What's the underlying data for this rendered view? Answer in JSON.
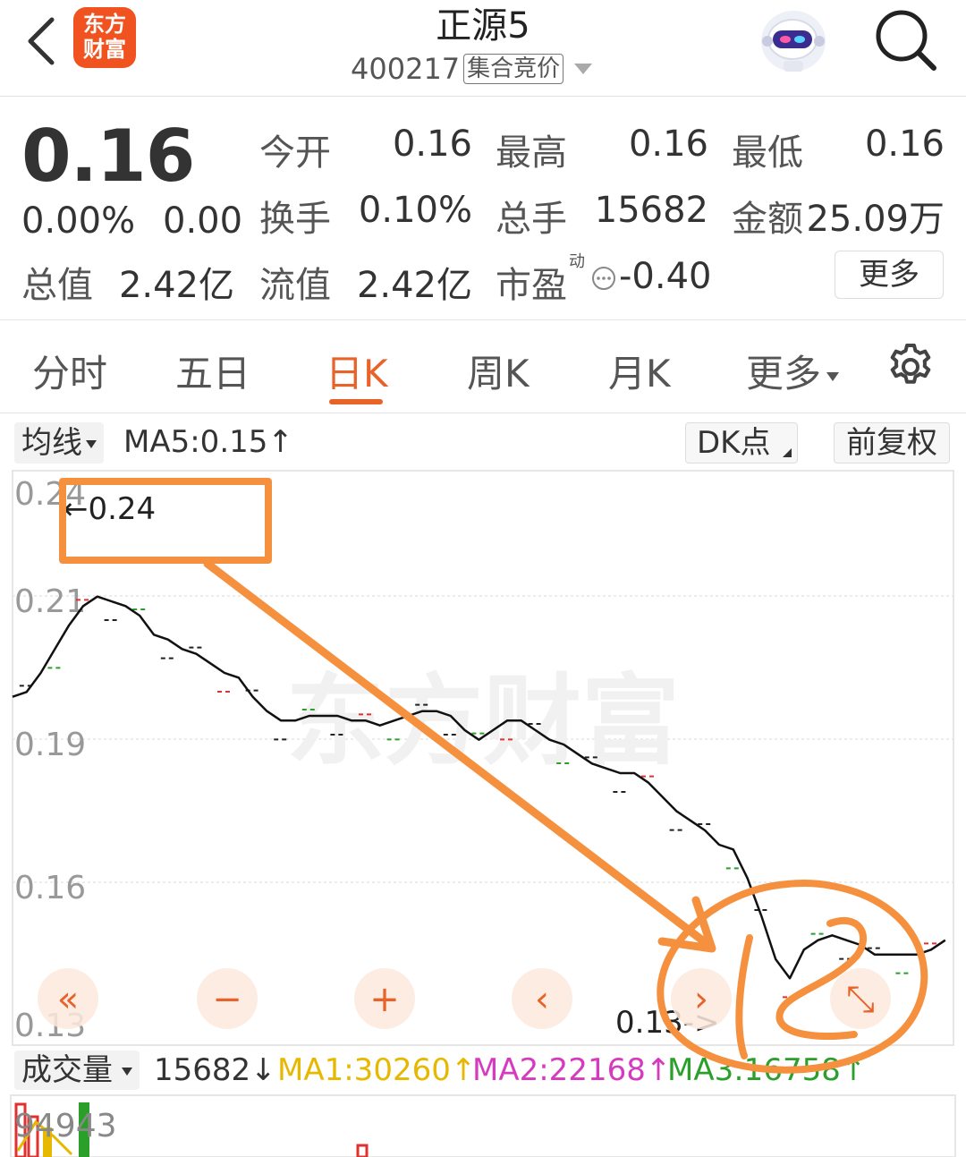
{
  "header": {
    "logo_text_1": "东方",
    "logo_text_2": "财富",
    "stock_name": "正源5",
    "stock_code": "400217",
    "market_badge": "集合竞价"
  },
  "quote": {
    "price": "0.16",
    "change_pct": "0.00%",
    "change_amt": "0.00",
    "open_label": "今开",
    "open_value": "0.16",
    "high_label": "最高",
    "high_value": "0.16",
    "low_label": "最低",
    "low_value": "0.16",
    "turnover_label": "换手",
    "turnover_value": "0.10%",
    "volume_label": "总手",
    "volume_value": "15682",
    "amount_label": "金额",
    "amount_value": "25.09万",
    "mktcap_label": "总值",
    "mktcap_value": "2.42亿",
    "float_label": "流值",
    "float_value": "2.42亿",
    "pe_label": "市盈",
    "pe_sup": "动",
    "pe_value": "-0.40",
    "more_label": "更多"
  },
  "tabs": [
    "分时",
    "五日",
    "日K",
    "周K",
    "月K",
    "更多"
  ],
  "indicator": {
    "ma_label": "均线",
    "ma5_text": "MA5:0.15↑",
    "dk_label": "DK点",
    "adjust_label": "前复权"
  },
  "chart_data": {
    "type": "line",
    "title": "",
    "y_ticks": [
      "0.24",
      "0.21",
      "0.19",
      "0.16",
      "0.13"
    ],
    "ylim": [
      0.13,
      0.24
    ],
    "grid": true,
    "watermark": "东方财富",
    "high_annotation": "←0.24",
    "low_annotation": "0.13->",
    "series": [
      {
        "color": "#111111",
        "values": [
          0.2,
          0.201,
          0.205,
          0.21,
          0.215,
          0.219,
          0.221,
          0.22,
          0.219,
          0.217,
          0.213,
          0.212,
          0.21,
          0.209,
          0.207,
          0.205,
          0.204,
          0.2,
          0.197,
          0.195,
          0.195,
          0.196,
          0.196,
          0.196,
          0.195,
          0.195,
          0.194,
          0.195,
          0.196,
          0.197,
          0.197,
          0.196,
          0.193,
          0.191,
          0.193,
          0.195,
          0.195,
          0.193,
          0.191,
          0.19,
          0.188,
          0.186,
          0.185,
          0.184,
          0.184,
          0.182,
          0.179,
          0.176,
          0.174,
          0.172,
          0.169,
          0.168,
          0.162,
          0.154,
          0.145,
          0.141,
          0.147,
          0.149,
          0.15,
          0.149,
          0.148,
          0.146,
          0.146,
          0.146,
          0.146,
          0.147,
          0.149
        ]
      }
    ]
  },
  "chart_controls": [
    "«",
    "−",
    "+",
    "‹",
    "›",
    "⤡"
  ],
  "volume": {
    "label": "成交量",
    "value": "15682↓",
    "ma1": "MA1:30260↑",
    "ma2": "MA2:22168↑",
    "ma3": "MA3:16758↑",
    "max_value": "94943"
  },
  "colors": {
    "accent": "#e8632a",
    "up": "#e03030",
    "down": "#2aa02a",
    "annotation": "#f5913e"
  }
}
